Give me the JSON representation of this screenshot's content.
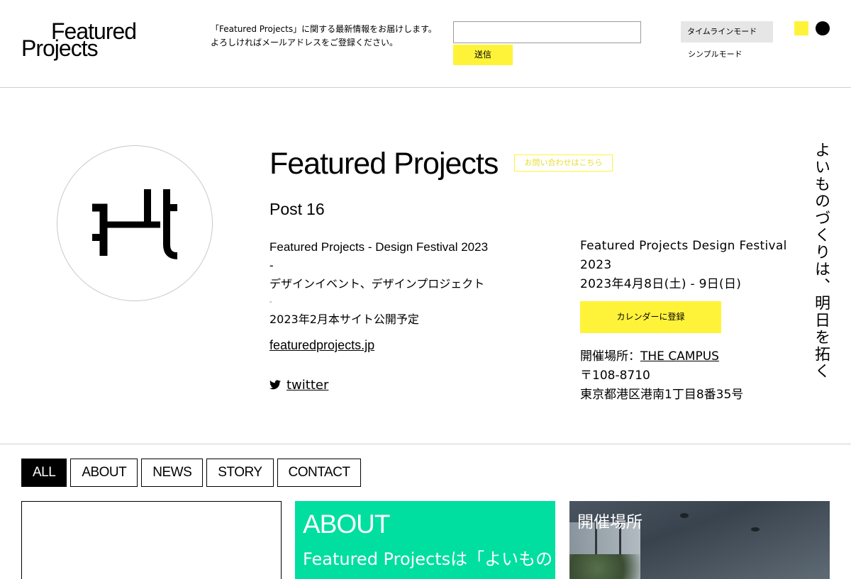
{
  "header": {
    "logo_line1": "Featured",
    "logo_line2": "Projects",
    "newsletter_line1": "「Featured Projects」に関する最新情報をお届けします。",
    "newsletter_line2": "よろしければメールアドレスをご登録ください。",
    "email_value": "",
    "email_placeholder": "",
    "submit_label": "送信",
    "mode_timeline": "タイムラインモード",
    "mode_simple": "シンプルモード",
    "colors": {
      "yellow": "#fff33a",
      "black": "#000000"
    }
  },
  "hero": {
    "title": "Featured Projects",
    "contact_label": "お問い合わせはこちら",
    "post_label": "Post",
    "post_number": "16",
    "desc_line1": "Featured Projects - Design Festival 2023",
    "desc_dash1": "-",
    "desc_line2": "デザインイベント、デザインプロジェクト",
    "desc_dash2": "-",
    "desc_line3": "2023年2月本サイト公開予定",
    "site_link": "featuredprojects.jp",
    "twitter_label": "twitter",
    "event_line1": "Featured Projects Design Festival",
    "event_line2": "2023",
    "event_dates": "2023年4月8日(土) - 9日(日)",
    "calendar_button": "カレンダーに登録",
    "venue_prefix": "開催場所：",
    "venue_name": "THE CAMPUS",
    "postal": "〒108-8710",
    "address": "東京都港区港南1丁目8番35号",
    "vertical_text": "よいものづくりは、明日を拓く"
  },
  "filters": [
    "ALL",
    "ABOUT",
    "NEWS",
    "STORY",
    "CONTACT"
  ],
  "cards": {
    "about_title": "ABOUT",
    "about_sub": "Featured Projectsは「よいもの",
    "venue_title": "開催場所"
  },
  "accent_color": "#00dea0"
}
